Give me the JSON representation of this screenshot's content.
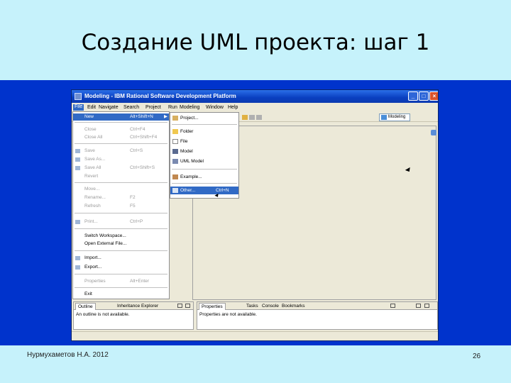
{
  "slide": {
    "title": "Создание UML проекта: шаг 1",
    "footer_author": "Нурмухаметов Н.А. 2012",
    "page_number": "26"
  },
  "window": {
    "title": "Modeling - IBM Rational Software Development Platform"
  },
  "menubar": {
    "items": [
      "File",
      "Edit",
      "Navigate",
      "Search",
      "Project",
      "Run",
      "Modeling",
      "Window",
      "Help"
    ]
  },
  "perspective": {
    "label": "Modeling"
  },
  "file_menu": {
    "items": [
      {
        "label": "New",
        "shortcut": "Alt+Shift+N",
        "enabled": true,
        "selected": true,
        "submenu": true
      },
      {
        "label": "Close",
        "shortcut": "Ctrl+F4"
      },
      {
        "label": "Close All",
        "shortcut": "Ctrl+Shift+F4"
      },
      {
        "label": "Save",
        "shortcut": "Ctrl+S"
      },
      {
        "label": "Save As..."
      },
      {
        "label": "Save All",
        "shortcut": "Ctrl+Shift+S"
      },
      {
        "label": "Revert"
      },
      {
        "label": "Move..."
      },
      {
        "label": "Rename...",
        "shortcut": "F2"
      },
      {
        "label": "Refresh",
        "shortcut": "F5"
      },
      {
        "label": "Print...",
        "shortcut": "Ctrl+P"
      },
      {
        "label": "Switch Workspace...",
        "enabled": true
      },
      {
        "label": "Open External File...",
        "enabled": true
      },
      {
        "label": "Import...",
        "enabled": true
      },
      {
        "label": "Export...",
        "enabled": true
      },
      {
        "label": "Properties",
        "shortcut": "Alt+Enter"
      },
      {
        "label": "Exit",
        "enabled": true
      }
    ]
  },
  "new_submenu": {
    "items": [
      {
        "label": "Project..."
      },
      {
        "label": "Folder"
      },
      {
        "label": "File"
      },
      {
        "label": "Model"
      },
      {
        "label": "UML Model"
      },
      {
        "label": "Example..."
      },
      {
        "label": "Other...",
        "shortcut": "Ctrl+N",
        "selected": true
      }
    ]
  },
  "outline_view": {
    "tabs": [
      "Outline",
      "Inheritance Explorer"
    ],
    "body": "An outline is not available."
  },
  "properties_view": {
    "tabs": [
      "Properties",
      "Tasks",
      "Console",
      "Bookmarks"
    ],
    "body": "Properties are not available."
  },
  "colors": {
    "slide_background": "#c6f2fb",
    "band": "#0033cc",
    "title_bar": "#0a3fc0",
    "selection": "#316ac5"
  }
}
